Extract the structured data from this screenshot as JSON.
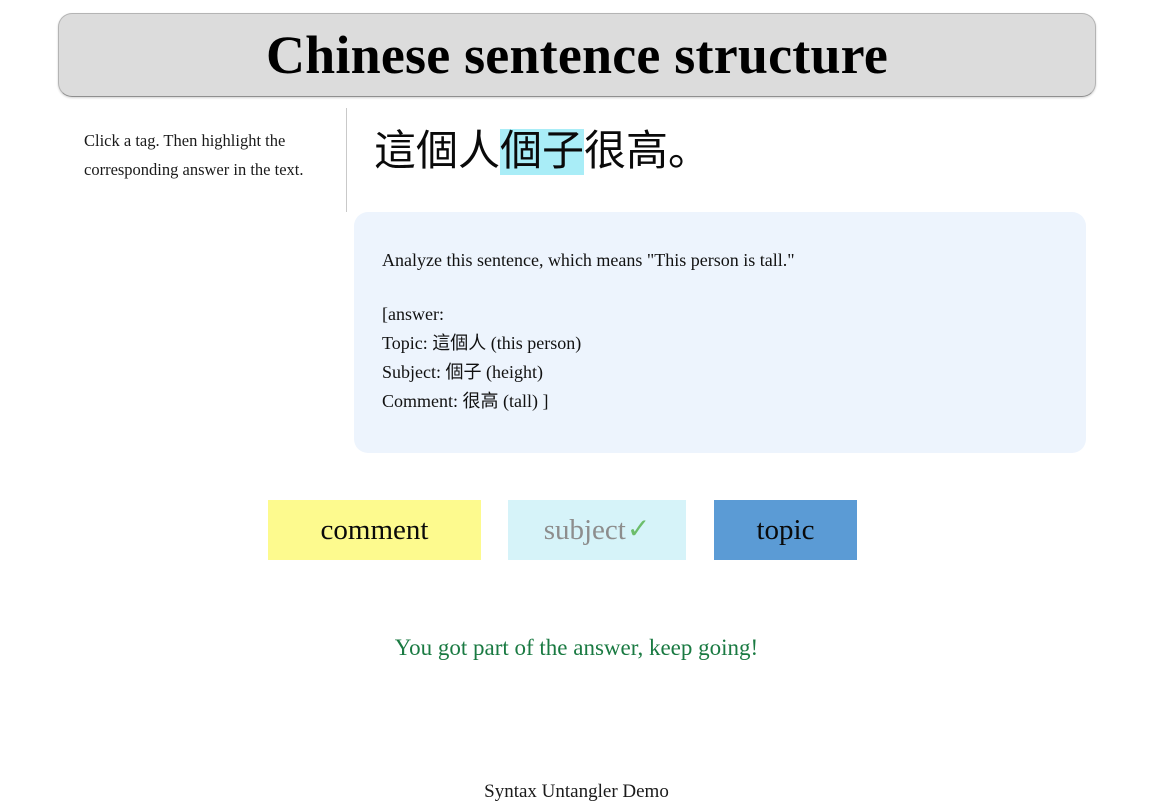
{
  "header": {
    "title": "Chinese sentence structure"
  },
  "sidebar": {
    "instructions": "Click a tag. Then highlight the corresponding answer in the text."
  },
  "sentence": {
    "full_text": "這個人個子很高。",
    "segments": [
      {
        "text": "這個人",
        "highlighted": false
      },
      {
        "text": "個子",
        "highlighted": true
      },
      {
        "text": "很高。",
        "highlighted": false
      }
    ],
    "highlight_color": "#a9edf7"
  },
  "prompt": {
    "question": "Analyze this sentence, which means \"This person is tall.\"",
    "answer_lines": [
      "[answer:",
      "Topic: 這個人 (this person)",
      "Subject: 個子 (height)",
      "Comment: 很高 (tall) ]"
    ],
    "background_color": "#edf4fd"
  },
  "tags": [
    {
      "label": "comment",
      "state": "available",
      "color": "#fdfa8e",
      "check": ""
    },
    {
      "label": "subject",
      "state": "completed",
      "color": "#d6f3f9",
      "check": "✓"
    },
    {
      "label": "topic",
      "state": "selected",
      "color": "#5b9bd5",
      "check": ""
    }
  ],
  "status": {
    "message": "You got part of the answer, keep going!",
    "color": "#1a7a42"
  },
  "footer": {
    "text": "Syntax Untangler Demo"
  }
}
